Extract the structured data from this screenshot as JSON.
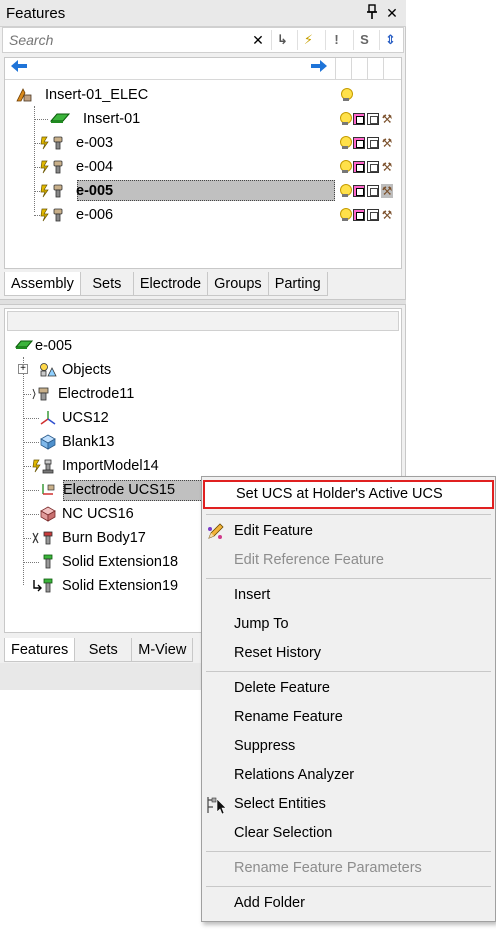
{
  "panel": {
    "title": "Features",
    "pin_icon": "pin-icon",
    "close_label": "✕"
  },
  "search": {
    "placeholder": "Search",
    "value": "",
    "clear_label": "✕",
    "buttons": [
      "↳",
      "⚡",
      "!",
      "S",
      "⇕"
    ]
  },
  "top_tree": {
    "root": "Insert-01_ELEC",
    "items": [
      {
        "label": "Insert-01",
        "selected": false
      },
      {
        "label": "e-003",
        "selected": false
      },
      {
        "label": "e-004",
        "selected": false
      },
      {
        "label": "e-005",
        "selected": true
      },
      {
        "label": "e-006",
        "selected": false
      }
    ]
  },
  "top_tabs": [
    "Assembly",
    "Sets",
    "Electrode",
    "Groups",
    "Parting"
  ],
  "bottom_tree": {
    "root": "e-005",
    "items": [
      "Objects",
      "Electrode11",
      "UCS12",
      "Blank13",
      "ImportModel14",
      "Electrode UCS15",
      "NC UCS16",
      "Burn Body17",
      "Solid Extension18",
      "Solid Extension19"
    ]
  },
  "bottom_tabs": [
    "Features",
    "Sets",
    "M-View"
  ],
  "context_menu": {
    "items": [
      {
        "label": "Set UCS at Holder's Active UCS",
        "highlighted": true,
        "disabled": false
      },
      {
        "label": "Edit Feature",
        "disabled": false
      },
      {
        "label": "Edit Reference Feature",
        "disabled": true
      },
      {
        "label": "Insert",
        "disabled": false
      },
      {
        "label": "Jump To",
        "disabled": false
      },
      {
        "label": "Reset History",
        "disabled": false
      },
      {
        "label": "Delete Feature",
        "disabled": false
      },
      {
        "label": "Rename Feature",
        "disabled": false
      },
      {
        "label": "Suppress",
        "disabled": false
      },
      {
        "label": "Relations Analyzer",
        "disabled": false
      },
      {
        "label": "Select Entities",
        "disabled": false
      },
      {
        "label": "Clear Selection",
        "disabled": false
      },
      {
        "label": "Rename Feature Parameters",
        "disabled": true
      },
      {
        "label": "Add Folder",
        "disabled": false
      }
    ]
  },
  "colors": {
    "highlight_border": "#e02020",
    "selection_bg": "#c0c0c0",
    "nav_arrow": "#1f74d8"
  }
}
